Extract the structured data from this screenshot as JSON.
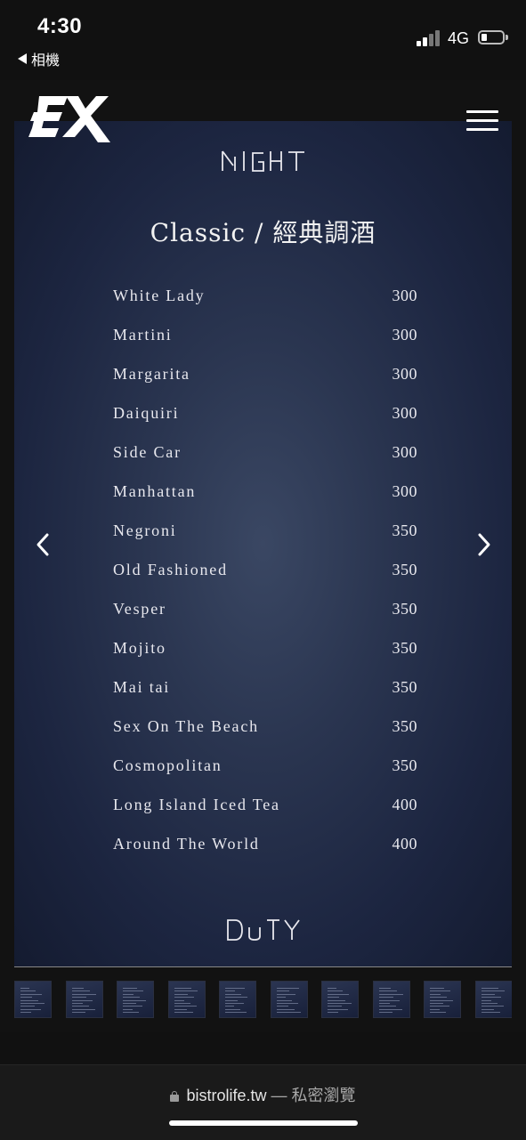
{
  "status_bar": {
    "time": "4:30",
    "back_label": "相機",
    "network": "4G"
  },
  "page": {
    "title": "Classic / 經典調酒",
    "menu_items": [
      {
        "name": "White Lady",
        "price": "300"
      },
      {
        "name": "Martini",
        "price": "300"
      },
      {
        "name": "Margarita",
        "price": "300"
      },
      {
        "name": "Daiquiri",
        "price": "300"
      },
      {
        "name": "Side Car",
        "price": "300"
      },
      {
        "name": "Manhattan",
        "price": "300"
      },
      {
        "name": "Negroni",
        "price": "350"
      },
      {
        "name": "Old Fashioned",
        "price": "350"
      },
      {
        "name": "Vesper",
        "price": "350"
      },
      {
        "name": "Mojito",
        "price": "350"
      },
      {
        "name": "Mai tai",
        "price": "350"
      },
      {
        "name": "Sex On The Beach",
        "price": "350"
      },
      {
        "name": "Cosmopolitan",
        "price": "350"
      },
      {
        "name": "Long Island Iced Tea",
        "price": "400"
      },
      {
        "name": "Around The World",
        "price": "400"
      }
    ],
    "thumbnail_count": 10
  },
  "icons": {
    "brand_logo": "ex-logo-icon",
    "night_logo": "night-logo-icon",
    "duty_logo": "duty-logo-icon",
    "menu": "hamburger-menu-icon",
    "prev": "chevron-left-icon",
    "next": "chevron-right-icon",
    "lock": "lock-icon"
  },
  "browser": {
    "domain": "bistrolife.tw",
    "suffix": " — 私密瀏覽"
  },
  "colors": {
    "panel_center": "#3a4763",
    "panel_edge": "#141b30",
    "background": "#111111"
  }
}
